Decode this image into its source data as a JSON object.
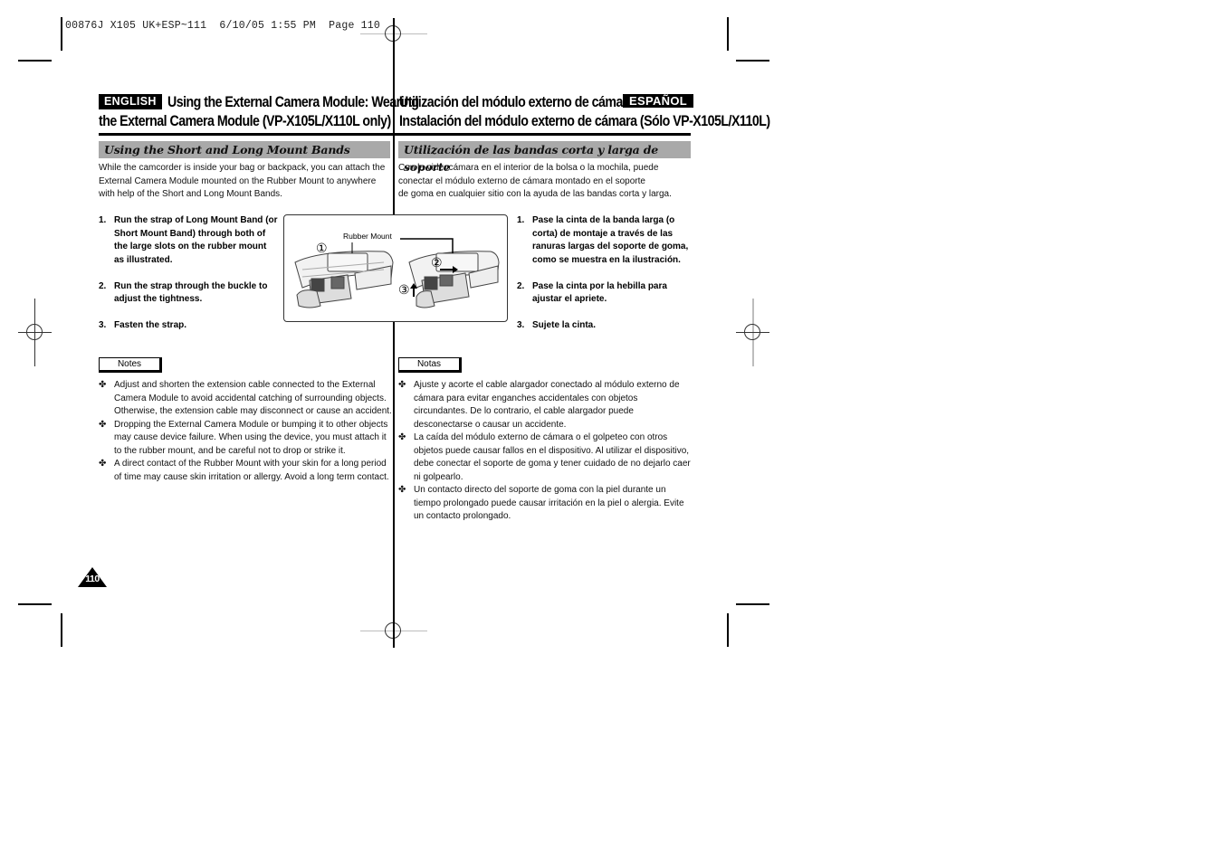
{
  "slug": {
    "text": "00876J X105 UK+ESP~111  6/10/05 1:55 PM  Page 110"
  },
  "english": {
    "badge": "ENGLISH",
    "title_line1": "Using the External Camera Module: Wearing",
    "title_line2": "the External Camera Module (VP-X105L/X110L only)",
    "section": "Using the Short and Long Mount Bands",
    "intro": "While the camcorder is inside your bag or backpack, you can attach the External Camera Module mounted on the Rubber Mount to anywhere with help of the Short and Long Mount Bands.",
    "steps": [
      {
        "num": "1.",
        "text": "Run the strap of Long Mount Band (or Short Mount Band) through both of the large slots on the rubber mount as illustrated."
      },
      {
        "num": "2.",
        "text": "Run the strap through the buckle to adjust the tightness."
      },
      {
        "num": "3.",
        "text": "Fasten the strap."
      }
    ],
    "notes_label": "Notes",
    "notes": [
      {
        "bullet": "✤",
        "text": "Adjust and shorten the extension cable connected to the External Camera Module to avoid accidental catching of surrounding objects.",
        "extra": "Otherwise, the extension cable may disconnect or cause an accident."
      },
      {
        "bullet": "✤",
        "text": "Dropping the External Camera Module or bumping it to other objects may cause device failure. When using the device, you must attach it to the rubber mount, and be careful not to drop or strike it.",
        "extra": ""
      },
      {
        "bullet": "✤",
        "text": "A direct contact of the Rubber Mount with your skin for a long period of time may cause skin irritation or allergy. Avoid a long term contact.",
        "extra": ""
      }
    ]
  },
  "spanish": {
    "badge": "ESPAÑOL",
    "title_line1": "Utilización del módulo externo de cámara:",
    "title_line2": "Instalación del módulo externo de cámara (Sólo VP-X105L/X110L)",
    "section": "Utilización de las bandas corta y larga de soporte",
    "intro": "Con la videocámara en el interior de la bolsa o la mochila, puede conectar el módulo externo de cámara montado en el soporte de goma en cualquier sitio con la ayuda de las bandas corta y larga.",
    "intro_lines": [
      "Con la videocámara en el interior de la bolsa o la mochila, puede",
      "conectar el módulo externo de cámara montado en el soporte",
      "de goma en cualquier sitio con la ayuda de las bandas corta y larga."
    ],
    "steps": [
      {
        "num": "1.",
        "text": "Pase la cinta de la banda larga (o corta) de montaje a través de las ranuras largas del soporte de goma, como se muestra en la ilustración."
      },
      {
        "num": "2.",
        "text": "Pase la cinta por la hebilla para ajustar el apriete."
      },
      {
        "num": "3.",
        "text": "Sujete la cinta."
      }
    ],
    "notes_label": "Notas",
    "notes": [
      {
        "bullet": "✤",
        "text": "Ajuste y acorte el cable alargador conectado al módulo externo de cámara para evitar enganches accidentales con objetos circundantes. De lo contrario, el cable alargador puede desconectarse o causar un accidente."
      },
      {
        "bullet": "✤",
        "text": "La caída del módulo externo de cámara o el golpeteo con otros objetos puede causar fallos en el dispositivo. Al utilizar el dispositivo, debe conectar el soporte de goma y tener cuidado de no dejarlo caer ni golpearlo."
      },
      {
        "bullet": "✤",
        "text": "Un contacto directo del soporte de goma con la piel durante un tiempo prolongado puede causar irritación en la piel o alergia. Evite un contacto prolongado."
      }
    ]
  },
  "figure": {
    "callout_label": "Rubber Mount",
    "step_markers": [
      "①",
      "②",
      "③"
    ]
  },
  "page_number": "110",
  "colors": {
    "section_bar": "#a9a9a9",
    "badge_bg": "#000000",
    "badge_text": "#ffffff"
  }
}
